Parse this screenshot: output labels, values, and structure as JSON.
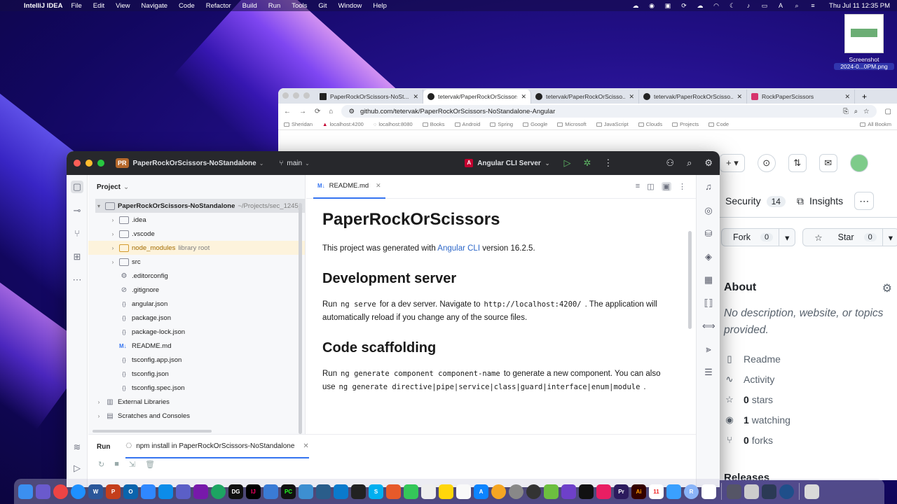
{
  "menubar": {
    "app": "IntelliJ IDEA",
    "menus": [
      "File",
      "Edit",
      "View",
      "Navigate",
      "Code",
      "Refactor",
      "Build",
      "Run",
      "Tools",
      "Git",
      "Window",
      "Help"
    ],
    "clock": "Thu Jul 11  12:35 PM"
  },
  "desktop": {
    "file_label_1": "Screenshot",
    "file_label_2": "2024-0...0PM.png"
  },
  "browser": {
    "tabs": [
      {
        "title": "PaperRockOrScissors-NoSt...",
        "icon": "app-icon"
      },
      {
        "title": "tetervak/PaperRockOrScissors...",
        "icon": "github-icon"
      },
      {
        "title": "tetervak/PaperRockOrScisso...",
        "icon": "github-icon"
      },
      {
        "title": "tetervak/PaperRockOrScisso...",
        "icon": "github-icon"
      },
      {
        "title": "RockPaperScissors",
        "icon": "angular-icon"
      }
    ],
    "url": "github.com/tetervak/PaperRockOrScissors-NoStandalone-Angular",
    "bookmarks": [
      "Sheridan",
      "localhost:4200",
      "localhost:8080",
      "Books",
      "Android",
      "Spring",
      "Google",
      "Microsoft",
      "JavaScript",
      "Clouds",
      "Projects",
      "Code"
    ],
    "bookmarks_all": "All Bookm",
    "github": {
      "tabs": [
        {
          "label": "Security",
          "count": "14"
        },
        {
          "label": "Insights",
          "count": ""
        }
      ],
      "fork_label": "Fork",
      "fork_count": "0",
      "star_label": "Star",
      "star_count": "0",
      "about_title": "About",
      "about_desc": "No description, website, or topics provided.",
      "about_items": [
        {
          "icon": "book-icon",
          "strong": "",
          "text": "Readme"
        },
        {
          "icon": "pulse-icon",
          "strong": "",
          "text": "Activity"
        },
        {
          "icon": "star-icon",
          "strong": "0",
          "text": "stars"
        },
        {
          "icon": "eye-icon",
          "strong": "1",
          "text": "watching"
        },
        {
          "icon": "fork-icon",
          "strong": "0",
          "text": "forks"
        }
      ],
      "releases": "Releases"
    }
  },
  "ide": {
    "project_badge": "PR",
    "project_name": "PaperRockOrScissors-NoStandalone",
    "branch": "main",
    "run_config": "Angular CLI Server",
    "panel_title": "Project",
    "tree": [
      {
        "depth": 0,
        "arrow": "▾",
        "type": "folder",
        "name": "PaperRockOrScissors-NoStandalone",
        "sub": "~/Projects/sec_1245_",
        "bold": true
      },
      {
        "depth": 1,
        "arrow": "›",
        "type": "folder",
        "name": ".idea",
        "sub": ""
      },
      {
        "depth": 1,
        "arrow": "›",
        "type": "folder",
        "name": ".vscode",
        "sub": ""
      },
      {
        "depth": 1,
        "arrow": "›",
        "type": "folder-y",
        "name": "node_modules",
        "sub": "library root"
      },
      {
        "depth": 1,
        "arrow": "›",
        "type": "folder",
        "name": "src",
        "sub": ""
      },
      {
        "depth": 1,
        "arrow": "",
        "type": "gear",
        "name": ".editorconfig",
        "sub": ""
      },
      {
        "depth": 1,
        "arrow": "",
        "type": "ignore",
        "name": ".gitignore",
        "sub": ""
      },
      {
        "depth": 1,
        "arrow": "",
        "type": "json",
        "name": "angular.json",
        "sub": ""
      },
      {
        "depth": 1,
        "arrow": "",
        "type": "json",
        "name": "package.json",
        "sub": ""
      },
      {
        "depth": 1,
        "arrow": "",
        "type": "json",
        "name": "package-lock.json",
        "sub": ""
      },
      {
        "depth": 1,
        "arrow": "",
        "type": "md",
        "name": "README.md",
        "sub": ""
      },
      {
        "depth": 1,
        "arrow": "",
        "type": "json",
        "name": "tsconfig.app.json",
        "sub": ""
      },
      {
        "depth": 1,
        "arrow": "",
        "type": "json",
        "name": "tsconfig.json",
        "sub": ""
      },
      {
        "depth": 1,
        "arrow": "",
        "type": "json",
        "name": "tsconfig.spec.json",
        "sub": ""
      },
      {
        "depth": 0,
        "arrow": "›",
        "type": "lib",
        "name": "External Libraries",
        "sub": ""
      },
      {
        "depth": 0,
        "arrow": "›",
        "type": "scratch",
        "name": "Scratches and Consoles",
        "sub": ""
      }
    ],
    "editor_tab": "README.md",
    "readme": {
      "h1": "PaperRockOrScissors",
      "p1_a": "This project was generated with ",
      "p1_link": "Angular CLI",
      "p1_b": " version 16.2.5.",
      "h2a": "Development server",
      "p2_a": "Run",
      "p2_code1": "ng serve",
      "p2_b": "for a dev server. Navigate to",
      "p2_code2": "http://localhost:4200/",
      "p2_c": ". The application will automatically reload if you change any of the source files.",
      "h2b": "Code scaffolding",
      "p3_a": "Run",
      "p3_code1": "ng generate component component-name",
      "p3_b": "to generate a new component. You can also use",
      "p3_code2": "ng generate directive|pipe|service|class|guard|interface|enum|module",
      "p3_c": "."
    },
    "run_label": "Run",
    "run_tab": "npm install in PaperRockOrScissors-NoStandalone"
  }
}
